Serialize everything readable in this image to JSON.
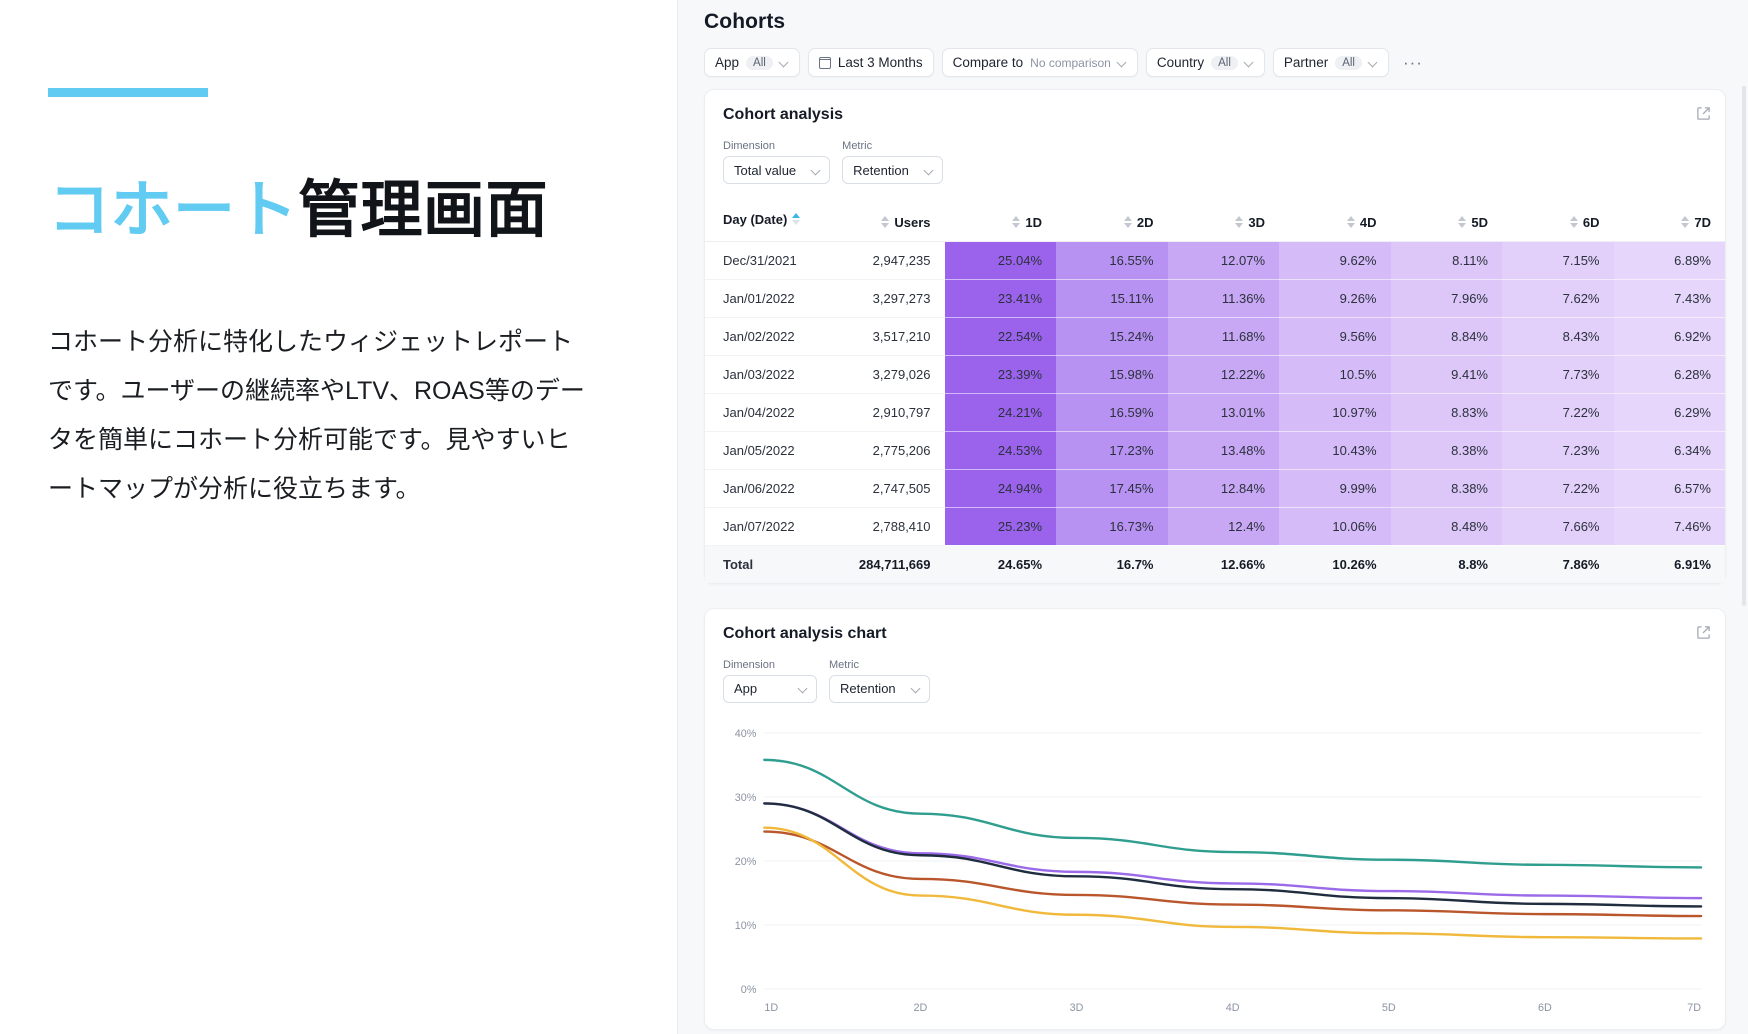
{
  "slide": {
    "accent_color": "#62cbf2",
    "title_cyan": "コホート",
    "title_black": "管理画面",
    "body": "コホート分析に特化したウィジェットレポートです。ユーザーの継続率やLTV、ROAS等のデータを簡単にコホート分析可能です。見やすいヒートマップが分析に役立ちます。"
  },
  "app": {
    "title": "Cohorts",
    "filters": [
      {
        "label": "App",
        "value": "All",
        "type": "pill"
      },
      {
        "label": "Last 3 Months",
        "value": "",
        "type": "date"
      },
      {
        "label": "Compare to",
        "value": "No comparison",
        "type": "text"
      },
      {
        "label": "Country",
        "value": "All",
        "type": "pill"
      },
      {
        "label": "Partner",
        "value": "All",
        "type": "pill"
      }
    ],
    "more_label": "•••"
  },
  "table_card": {
    "title": "Cohort analysis",
    "dimension_label": "Dimension",
    "dimension_value": "Total value",
    "metric_label": "Metric",
    "metric_value": "Retention",
    "export_icon": "external-link-icon",
    "columns": [
      "Day (Date)",
      "Users",
      "1D",
      "2D",
      "3D",
      "4D",
      "5D",
      "6D",
      "7D"
    ],
    "rows": [
      {
        "day": "Dec/31/2021",
        "users": "2,947,235",
        "vals": [
          "25.04%",
          "16.55%",
          "12.07%",
          "9.62%",
          "8.11%",
          "7.15%",
          "6.89%"
        ]
      },
      {
        "day": "Jan/01/2022",
        "users": "3,297,273",
        "vals": [
          "23.41%",
          "15.11%",
          "11.36%",
          "9.26%",
          "7.96%",
          "7.62%",
          "7.43%"
        ]
      },
      {
        "day": "Jan/02/2022",
        "users": "3,517,210",
        "vals": [
          "22.54%",
          "15.24%",
          "11.68%",
          "9.56%",
          "8.84%",
          "8.43%",
          "6.92%"
        ]
      },
      {
        "day": "Jan/03/2022",
        "users": "3,279,026",
        "vals": [
          "23.39%",
          "15.98%",
          "12.22%",
          "10.5%",
          "9.41%",
          "7.73%",
          "6.28%"
        ]
      },
      {
        "day": "Jan/04/2022",
        "users": "2,910,797",
        "vals": [
          "24.21%",
          "16.59%",
          "13.01%",
          "10.97%",
          "8.83%",
          "7.22%",
          "6.29%"
        ]
      },
      {
        "day": "Jan/05/2022",
        "users": "2,775,206",
        "vals": [
          "24.53%",
          "17.23%",
          "13.48%",
          "10.43%",
          "8.38%",
          "7.23%",
          "6.34%"
        ]
      },
      {
        "day": "Jan/06/2022",
        "users": "2,747,505",
        "vals": [
          "24.94%",
          "17.45%",
          "12.84%",
          "9.99%",
          "8.38%",
          "7.22%",
          "6.57%"
        ]
      },
      {
        "day": "Jan/07/2022",
        "users": "2,788,410",
        "vals": [
          "25.23%",
          "16.73%",
          "12.4%",
          "10.06%",
          "8.48%",
          "7.66%",
          "7.46%"
        ]
      }
    ],
    "total": {
      "day": "Total",
      "users": "284,711,669",
      "vals": [
        "24.65%",
        "16.7%",
        "12.66%",
        "10.26%",
        "8.8%",
        "7.86%",
        "6.91%"
      ]
    },
    "heatmap_colors": [
      "#9b63ec",
      "#b892f2",
      "#c8a8f5",
      "#d5bbf8",
      "#ddc7f9",
      "#e2cffa",
      "#e6d6fb"
    ]
  },
  "chart_card": {
    "title": "Cohort analysis chart",
    "dimension_label": "Dimension",
    "dimension_value": "App",
    "metric_label": "Metric",
    "metric_value": "Retention",
    "export_icon": "external-link-icon"
  },
  "chart_data": {
    "type": "line",
    "title": "Cohort analysis chart",
    "xlabel": "",
    "ylabel": "",
    "x": [
      "1D",
      "2D",
      "3D",
      "4D",
      "5D",
      "6D",
      "7D"
    ],
    "ylim": [
      0,
      40
    ],
    "yticks": [
      0,
      10,
      20,
      30,
      40
    ],
    "ytick_labels": [
      "0%",
      "10%",
      "20%",
      "30%",
      "40%"
    ],
    "grid": true,
    "legend": "none",
    "series": [
      {
        "name": "series-teal",
        "color": "#2f9e8f",
        "values": [
          35.8,
          27.4,
          23.6,
          21.4,
          20.2,
          19.4,
          19.0
        ]
      },
      {
        "name": "series-purple",
        "color": "#9b6ae8",
        "values": [
          29.0,
          21.2,
          18.3,
          16.5,
          15.3,
          14.6,
          14.2
        ]
      },
      {
        "name": "series-navy",
        "color": "#1f2d3f",
        "values": [
          29.0,
          20.9,
          17.6,
          15.6,
          14.2,
          13.3,
          12.9
        ]
      },
      {
        "name": "series-orange",
        "color": "#b9562b",
        "values": [
          24.6,
          17.2,
          14.7,
          13.2,
          12.3,
          11.7,
          11.4
        ]
      },
      {
        "name": "series-yellow",
        "color": "#f0b93b",
        "values": [
          25.2,
          14.6,
          11.6,
          9.7,
          8.7,
          8.1,
          7.9
        ]
      }
    ]
  }
}
